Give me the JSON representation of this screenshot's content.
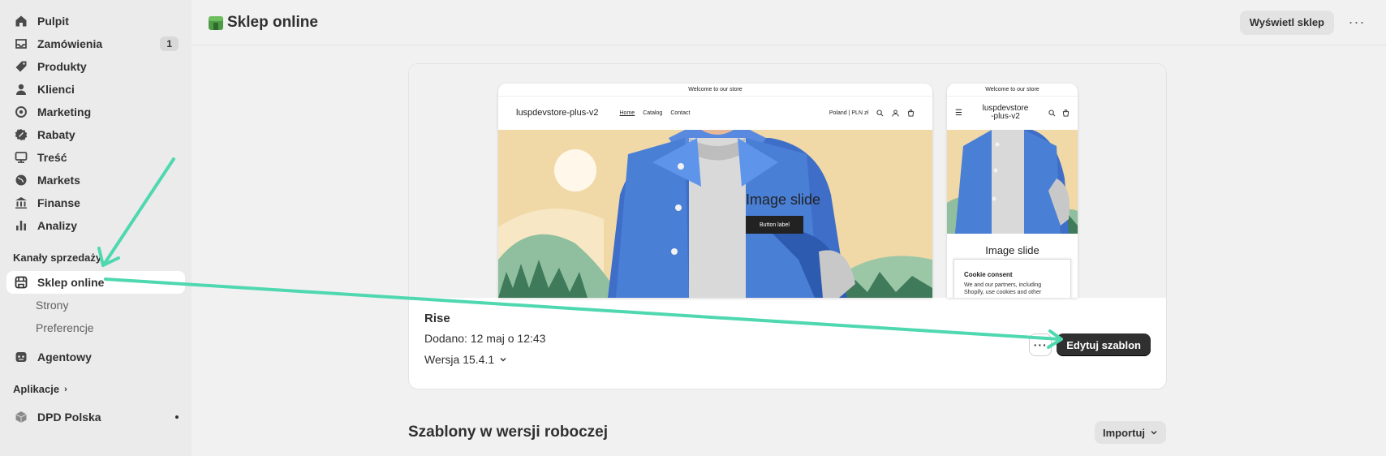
{
  "sidebar": {
    "items": [
      {
        "label": "Pulpit",
        "icon": "home-icon"
      },
      {
        "label": "Zamówienia",
        "icon": "inbox-icon",
        "badge": "1"
      },
      {
        "label": "Produkty",
        "icon": "tag-icon"
      },
      {
        "label": "Klienci",
        "icon": "person-icon"
      },
      {
        "label": "Marketing",
        "icon": "target-icon"
      },
      {
        "label": "Rabaty",
        "icon": "discount-icon"
      },
      {
        "label": "Treść",
        "icon": "content-icon"
      },
      {
        "label": "Markets",
        "icon": "globe-icon"
      },
      {
        "label": "Finanse",
        "icon": "bank-icon"
      },
      {
        "label": "Analizy",
        "icon": "bar-chart-icon"
      }
    ],
    "sales_channels_label": "Kanały sprzedaży",
    "online_store": {
      "label": "Sklep online",
      "icon": "store-icon"
    },
    "online_store_sub": [
      "Strony",
      "Preferencje"
    ],
    "agents": {
      "label": "Agentowy",
      "icon": "agent-icon"
    },
    "apps_label": "Aplikacje",
    "app_item": {
      "label": "DPD Polska",
      "icon": "app-icon"
    }
  },
  "topbar": {
    "title": "Sklep online",
    "view_store_label": "Wyświetl sklep",
    "more_label": "···"
  },
  "theme": {
    "name": "Rise",
    "added": "Dodano: 12 maj o 12:43",
    "version": "Wersja 15.4.1",
    "more_label": "···",
    "edit_label": "Edytuj szablon"
  },
  "preview": {
    "desktop": {
      "announcement": "Welcome to our store",
      "logo": "luspdevstore-plus-v2",
      "nav": [
        "Home",
        "Catalog",
        "Contact"
      ],
      "locale": "Poland | PLN zł",
      "hero_title": "Image slide",
      "hero_button": "Button label"
    },
    "mobile": {
      "announcement": "Welcome to our store",
      "logo_line1": "luspdevstore",
      "logo_line2": "-plus-v2",
      "hero_title": "Image slide",
      "cookie_title": "Cookie consent",
      "cookie_text": "We and our partners, including Shopify, use cookies and other"
    }
  },
  "drafts": {
    "title": "Szablony w wersji roboczej",
    "import_label": "Importuj"
  },
  "colors": {
    "accent_arrow": "#4fd8b0",
    "primary_button": "#303030"
  }
}
